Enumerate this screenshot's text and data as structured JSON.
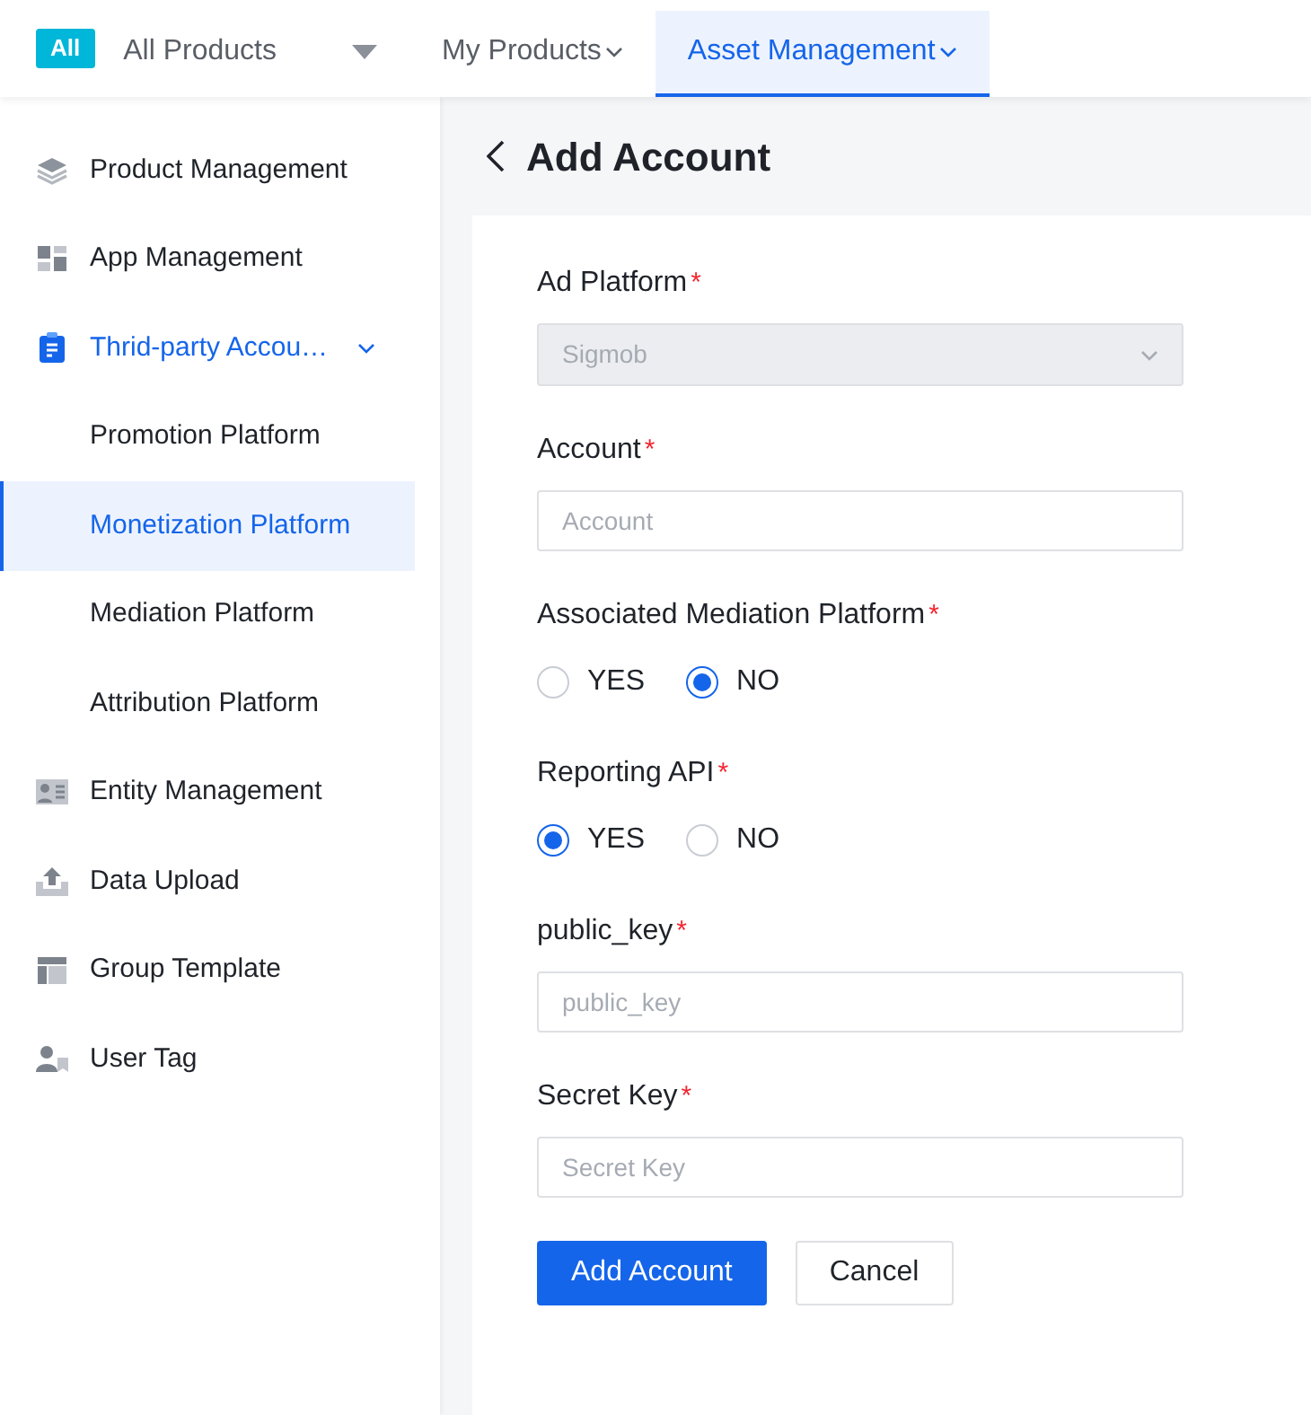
{
  "top_nav": {
    "badge": "All",
    "items": [
      {
        "label": "All Products",
        "kind": "triangle",
        "selected": false
      },
      {
        "label": "My Products",
        "kind": "chevron",
        "selected": false
      },
      {
        "label": "Asset Management",
        "kind": "chevron",
        "selected": true
      }
    ]
  },
  "sidebar": {
    "items": [
      {
        "label": "Product Management",
        "selected": false
      },
      {
        "label": "App Management",
        "selected": false
      },
      {
        "label": "Thrid-party Accou…",
        "selected": false,
        "expanded": true,
        "children": [
          {
            "label": "Promotion Platform",
            "selected": false
          },
          {
            "label": "Monetization Platform",
            "selected": true
          },
          {
            "label": "Mediation Platform",
            "selected": false
          },
          {
            "label": "Attribution Platform",
            "selected": false
          }
        ]
      },
      {
        "label": "Entity Management",
        "selected": false
      },
      {
        "label": "Data Upload",
        "selected": false
      },
      {
        "label": "Group Template",
        "selected": false
      },
      {
        "label": "User Tag",
        "selected": false
      }
    ]
  },
  "page": {
    "title": "Add Account"
  },
  "form": {
    "fields": [
      {
        "kind": "select",
        "label": "Ad Platform",
        "required_mark": "*",
        "value": "Sigmob",
        "disabled": true
      },
      {
        "kind": "input",
        "label": "Account",
        "required_mark": "*",
        "placeholder": "Account"
      },
      {
        "kind": "radio",
        "label": "Associated Mediation Platform",
        "required_mark": "*",
        "options": [
          {
            "label": "YES",
            "selected": false
          },
          {
            "label": "NO",
            "selected": true
          }
        ]
      },
      {
        "kind": "radio",
        "label": "Reporting API",
        "required_mark": "*",
        "options": [
          {
            "label": "YES",
            "selected": true
          },
          {
            "label": "NO",
            "selected": false
          }
        ]
      },
      {
        "kind": "input",
        "label": "public_key",
        "required_mark": "*",
        "placeholder": "public_key"
      },
      {
        "kind": "input",
        "label": "Secret Key",
        "required_mark": "*",
        "placeholder": "Secret Key"
      }
    ],
    "buttons": [
      {
        "label": "Add Account",
        "kind": "primary"
      },
      {
        "label": "Cancel",
        "kind": "default"
      }
    ]
  }
}
